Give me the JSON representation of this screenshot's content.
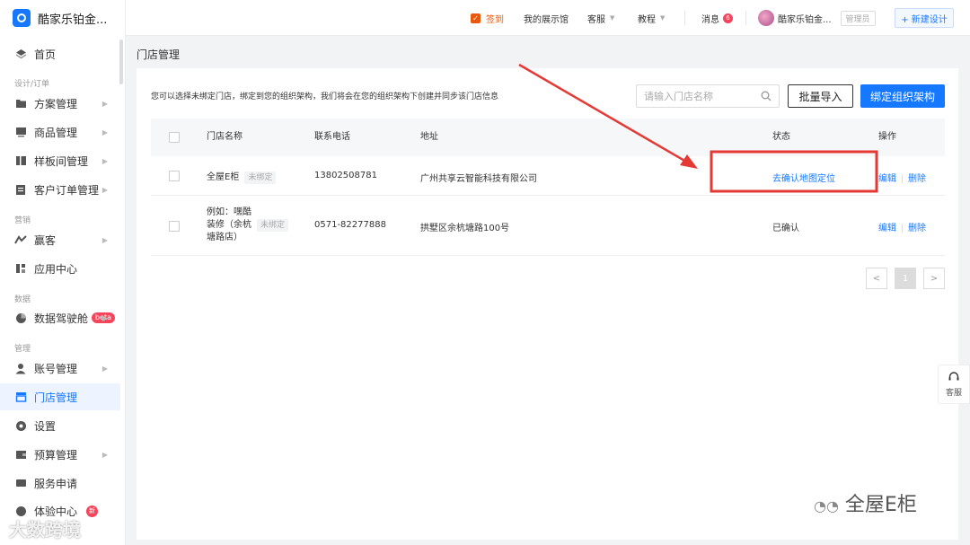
{
  "app": {
    "title": "酷家乐铂金..."
  },
  "sidebar": {
    "items": [
      {
        "label": "首页",
        "icon": "home-icon"
      },
      {
        "label": "方案管理",
        "icon": "folder-icon"
      },
      {
        "label": "商品管理",
        "icon": "product-icon"
      },
      {
        "label": "样板间管理",
        "icon": "sample-room-icon"
      },
      {
        "label": "客户订单管理",
        "icon": "order-icon"
      },
      {
        "label": "赢客",
        "icon": "leads-icon"
      },
      {
        "label": "应用中心",
        "icon": "apps-icon"
      },
      {
        "label": "数据驾驶舱",
        "icon": "pie-chart-icon",
        "badge": "beta"
      },
      {
        "label": "账号管理",
        "icon": "user-icon"
      },
      {
        "label": "门店管理",
        "icon": "store-icon"
      },
      {
        "label": "设置",
        "icon": "gear-icon"
      },
      {
        "label": "预算管理",
        "icon": "wallet-icon"
      },
      {
        "label": "服务申请",
        "icon": "service-icon"
      },
      {
        "label": "体验中心",
        "icon": "experience-icon",
        "badge": "新"
      }
    ],
    "sections": [
      "设计/订单",
      "营销",
      "数据",
      "管理"
    ]
  },
  "header": {
    "signin": "签到",
    "showroom": "我的展示馆",
    "service": "客服",
    "tutorial": "教程",
    "messages": "消息",
    "message_count": "6",
    "user_name": "酷家乐铂金...",
    "role": "管理员",
    "new_design": "+ 新建设计"
  },
  "page": {
    "title": "门店管理",
    "tip": "您可以选择未绑定门店，绑定到您的组织架构，我们将会在您的组织架构下创建并同步该门店信息",
    "search_placeholder": "请输入门店名称",
    "batch_import": "批量导入",
    "bind_org": "绑定组织架构"
  },
  "table": {
    "columns": [
      "门店名称",
      "联系电话",
      "地址",
      "状态",
      "操作"
    ],
    "rows": [
      {
        "name": "全屋E柜",
        "tag": "未绑定",
        "phone": "13802508781",
        "address": "广州共享云智能科技有限公司",
        "status": "去确认地图定位",
        "edit": "编辑",
        "delete": "删除"
      },
      {
        "name_l1": "例如：嘿酷",
        "name_l2": "装修（余杭",
        "name_l3": "塘路店）",
        "tag": "未绑定",
        "phone": "0571-82277888",
        "address": "拱墅区余杭塘路100号",
        "status": "已确认",
        "edit": "编辑",
        "delete": "删除"
      }
    ]
  },
  "pagination": {
    "prev": "<",
    "current": "1",
    "next": ">"
  },
  "float_service": {
    "label": "客服"
  },
  "watermarks": {
    "left": "大数跨境",
    "right": "全屋E柜"
  },
  "colors": {
    "accent": "#1677ff",
    "annotation": "#e53935"
  }
}
